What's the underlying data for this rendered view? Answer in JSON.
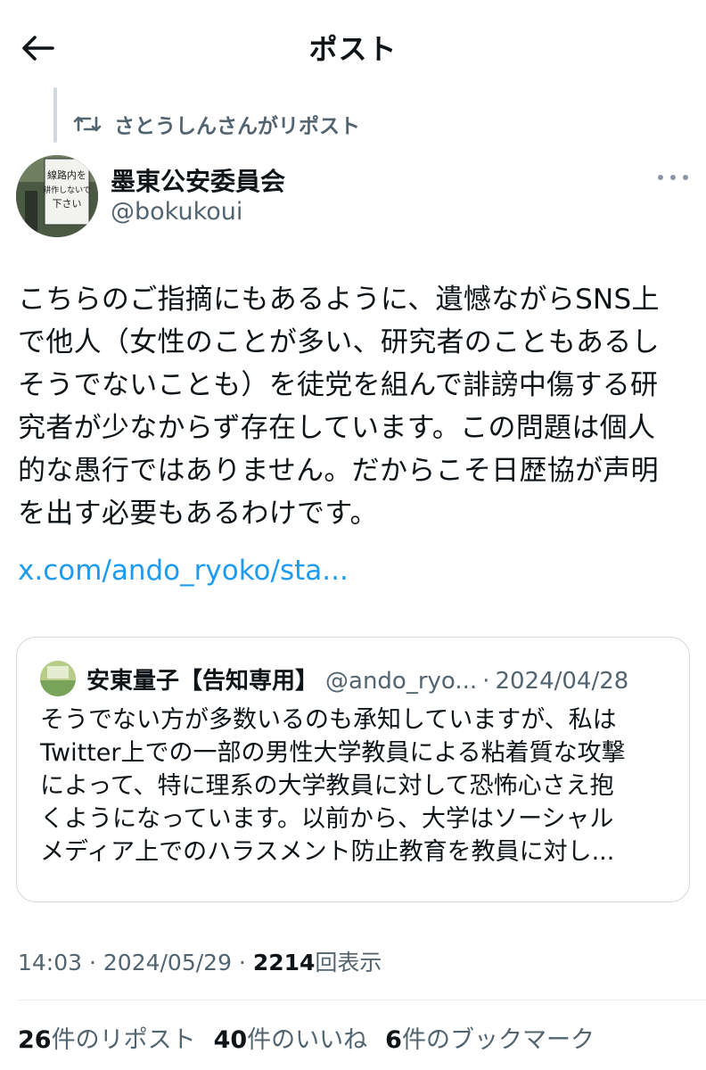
{
  "header": {
    "title": "ポスト",
    "back_icon": "arrow-left-icon"
  },
  "repost": {
    "label": "さとうしんさんがリポスト",
    "icon": "repost-icon"
  },
  "author": {
    "name": "墨東公安委員会",
    "handle": "@bokukoui",
    "avatar_sign_text": [
      "線路内を",
      "耕作しないで",
      "下さい"
    ]
  },
  "post": {
    "lines": [
      "こちらのご指摘にもあるように、遺憾ながらSNS上",
      "で他人（女性のことが多い、研究者のこともあるし",
      "そうでないことも）を徒党を組んで誹謗中傷する研",
      "究者が少なからず存在しています。この問題は個人",
      "的な愚行ではありません。だからこそ日歴協が声明",
      "を出す必要もあるわけです。"
    ],
    "link": "x.com/ando_ryoko/sta..."
  },
  "quote": {
    "name": "安東量子【告知専用】",
    "handle": "@ando_ryo...",
    "separator": "·",
    "date": "2024/04/28",
    "lines": [
      "そうでない方が多数いるのも承知していますが、私は",
      "Twitter上での一部の男性大学教員による粘着質な攻撃",
      "によって、特に理系の大学教員に対して恐怖心さえ抱",
      "くようになっています。以前から、大学はソーシャル",
      "メディア上でのハラスメント防止教育を教員に対し..."
    ]
  },
  "meta": {
    "time": "14:03",
    "separator": " · ",
    "date": "2024/05/29",
    "views_count": "2214",
    "views_label": "回表示"
  },
  "stats": {
    "reposts_count": "26",
    "reposts_label": "件のリポスト",
    "likes_count": "40",
    "likes_label": "件のいいね",
    "bookmarks_count": "6",
    "bookmarks_label": "件のブックマーク"
  },
  "colors": {
    "link": "#1d9bf0",
    "secondary_text": "#536471",
    "primary_text": "#0f1419",
    "border": "#cfd9de"
  }
}
